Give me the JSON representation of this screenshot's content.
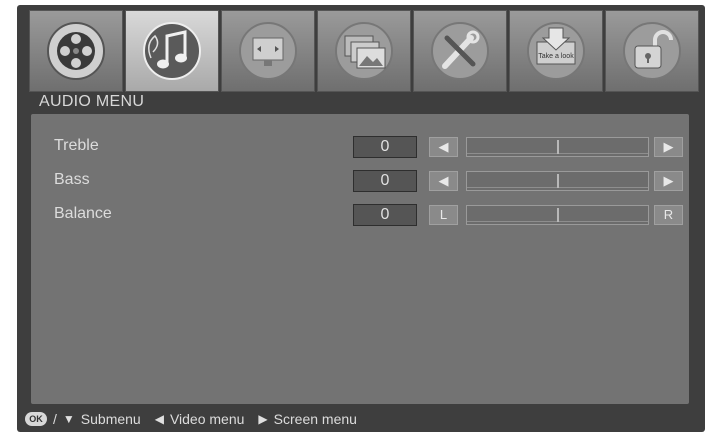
{
  "menu_title": "AUDIO  MENU",
  "icons": [
    {
      "name": "film-reel-icon",
      "active": false
    },
    {
      "name": "music-note-icon",
      "active": true
    },
    {
      "name": "screen-display-icon",
      "active": false
    },
    {
      "name": "photos-icon",
      "active": false
    },
    {
      "name": "tools-icon",
      "active": false
    },
    {
      "name": "take-a-look-icon",
      "active": false,
      "text": "Take a look"
    },
    {
      "name": "lock-icon",
      "active": false
    }
  ],
  "settings": [
    {
      "label": "Treble",
      "value": "0",
      "left": "◀",
      "right": "▶",
      "level": 0.5
    },
    {
      "label": "Bass",
      "value": "0",
      "left": "◀",
      "right": "▶",
      "level": 0.5
    },
    {
      "label": "Balance",
      "value": "0",
      "left": "L",
      "right": "R",
      "level": 0.5
    }
  ],
  "footer": {
    "ok": "OK",
    "slash": "/",
    "down_arrow": "▼",
    "submenu": "Submenu",
    "left_arrow": "◀",
    "video_menu": "Video menu",
    "right_arrow": "▶",
    "screen_menu": "Screen menu"
  }
}
